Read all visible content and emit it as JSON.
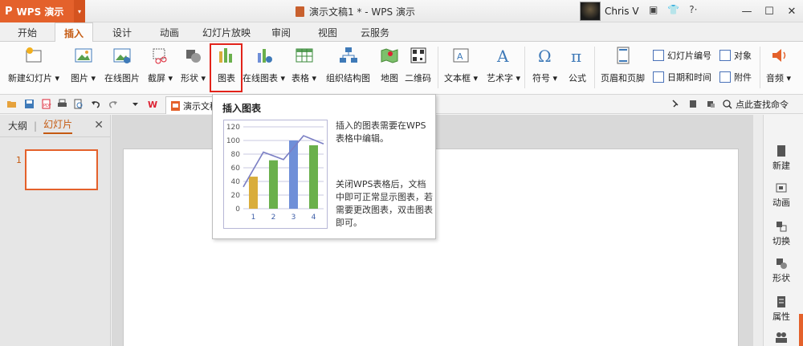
{
  "app": {
    "name": "WPS 演示",
    "dropdown_glyph": "▾",
    "logo_glyph": "P"
  },
  "window": {
    "title": "演示文稿1 * - WPS 演示",
    "minimize": "—",
    "restore": "☐",
    "close": "✕"
  },
  "user": {
    "name": "Chris V"
  },
  "title_icons": [
    "▣",
    "👕",
    "?·"
  ],
  "tabs": [
    {
      "label": "开始"
    },
    {
      "label": "插入",
      "active": true
    },
    {
      "label": "设计"
    },
    {
      "label": "动画"
    },
    {
      "label": "幻灯片放映"
    },
    {
      "label": "审阅"
    },
    {
      "label": "视图"
    },
    {
      "label": "云服务"
    }
  ],
  "ribbon": {
    "new_slide": "新建幻灯片 ▾",
    "picture": "图片 ▾",
    "online_picture": "在线图片",
    "screenshot": "截屏 ▾",
    "shape": "形状 ▾",
    "chart": "图表",
    "online_chart": "在线图表 ▾",
    "table": "表格 ▾",
    "org_chart": "组织结构图",
    "map": "地图",
    "qrcode": "二维码",
    "textbox": "文本框 ▾",
    "wordart": "艺术字 ▾",
    "symbol": "符号 ▾",
    "formula": "公式",
    "header_footer": "页眉和页脚",
    "slide_number": "幻灯片编号",
    "object": "对象",
    "datetime": "日期和时间",
    "attachment": "附件",
    "audio": "音频 ▾"
  },
  "quick": {
    "doc_tab": "演示文稿",
    "search_cmd": "点此查找命令"
  },
  "left_pane": {
    "tab_outline": "大纲",
    "tab_slides": "幻灯片",
    "slide_number": "1"
  },
  "right_pane": {
    "new": "新建",
    "animation": "动画",
    "transition": "切换",
    "shape": "形状",
    "properties": "属性"
  },
  "tooltip": {
    "title": "插入图表",
    "para1": "插入的图表需要在WPS表格中编辑。",
    "para2": "关闭WPS表格后，文档中即可正常显示图表，若需要更改图表，双击图表即可。"
  },
  "chart_data": {
    "type": "bar",
    "categories": [
      "1",
      "2",
      "3",
      "4"
    ],
    "values": [
      47,
      71,
      100,
      93
    ],
    "bar_colors": [
      "#d9ad3c",
      "#6ab04c",
      "#6f8fd8",
      "#6ab04c"
    ],
    "line_values": [
      32,
      83,
      72,
      107,
      95
    ],
    "ylim": [
      0,
      120
    ],
    "yticks": [
      "0",
      "20",
      "40",
      "60",
      "80",
      "100",
      "120"
    ],
    "grid": true
  }
}
